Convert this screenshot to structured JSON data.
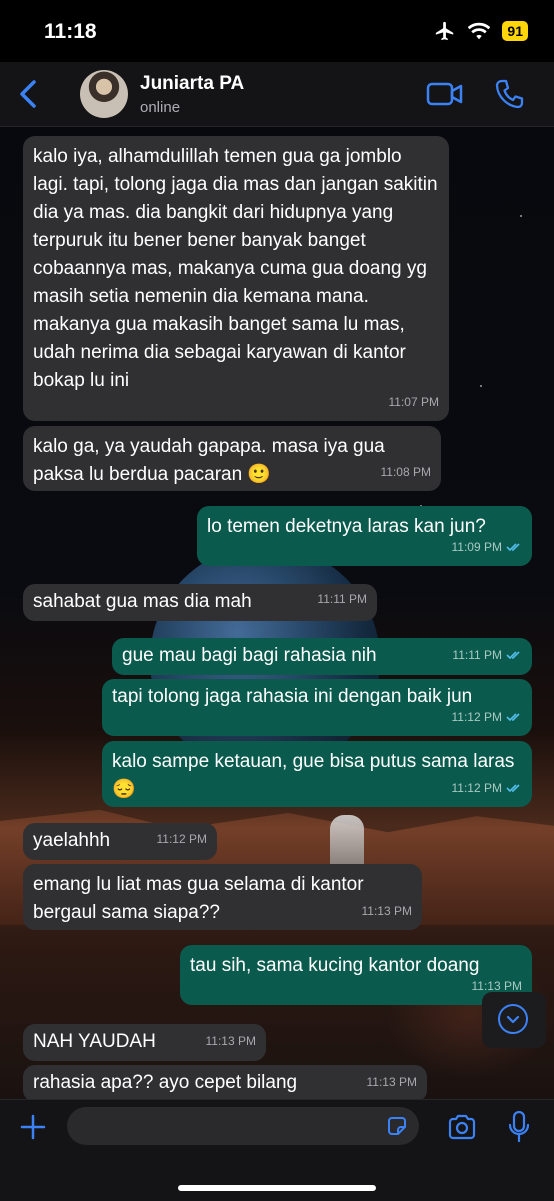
{
  "status_bar": {
    "time": "11:18",
    "battery": "91"
  },
  "header": {
    "contact_name": "Juniarta PA",
    "contact_status": "online"
  },
  "messages": [
    {
      "dir": "in",
      "text": "kalo iya, alhamdulillah temen gua ga jomblo lagi. tapi, tolong jaga dia mas dan jangan sakitin dia ya mas. dia bangkit dari hidupnya yang terpuruk itu bener bener banyak banget cobaannya mas, makanya cuma gua doang yg masih setia nemenin dia kemana mana. makanya gua makasih banget sama lu mas, udah nerima dia sebagai karyawan di kantor bokap lu ini",
      "time": "11:07 PM"
    },
    {
      "dir": "in",
      "text": "kalo ga, ya yaudah gapapa. masa iya gua paksa lu berdua pacaran 🙂",
      "time": "11:08 PM"
    },
    {
      "dir": "out",
      "text": "lo temen deketnya laras kan jun?",
      "time": "11:09 PM"
    },
    {
      "dir": "in",
      "text": "sahabat gua mas dia mah",
      "time": "11:11 PM"
    },
    {
      "dir": "out",
      "text": "gue mau bagi bagi rahasia nih",
      "time": "11:11 PM"
    },
    {
      "dir": "out",
      "text": "tapi tolong jaga rahasia ini dengan baik jun",
      "time": "11:12 PM"
    },
    {
      "dir": "out",
      "text": "kalo sampe ketauan, gue bisa putus sama laras 😔",
      "time": "11:12 PM"
    },
    {
      "dir": "in",
      "text": "yaelahhh",
      "time": "11:12 PM"
    },
    {
      "dir": "in",
      "text": "emang lu liat mas gua selama di kantor bergaul sama siapa??",
      "time": "11:13 PM"
    },
    {
      "dir": "out",
      "text": "tau sih, sama kucing kantor doang",
      "time": "11:13 PM"
    },
    {
      "dir": "in",
      "text": "NAH YAUDAH",
      "time": "11:13 PM"
    },
    {
      "dir": "in",
      "text": "rahasia apa?? ayo cepet bilang",
      "time": "11:13 PM"
    }
  ],
  "composer": {
    "value": "",
    "placeholder": ""
  },
  "colors": {
    "accent": "#3b82f6",
    "incoming": "#303033",
    "outgoing": "#0a5b4e",
    "read_check": "#53bdeb"
  },
  "icons": [
    "airplane-icon",
    "wifi-icon",
    "back-chevron-icon",
    "video-call-icon",
    "phone-icon",
    "plus-icon",
    "sticker-icon",
    "camera-icon",
    "mic-icon",
    "chevron-down-icon",
    "double-check-icon"
  ]
}
